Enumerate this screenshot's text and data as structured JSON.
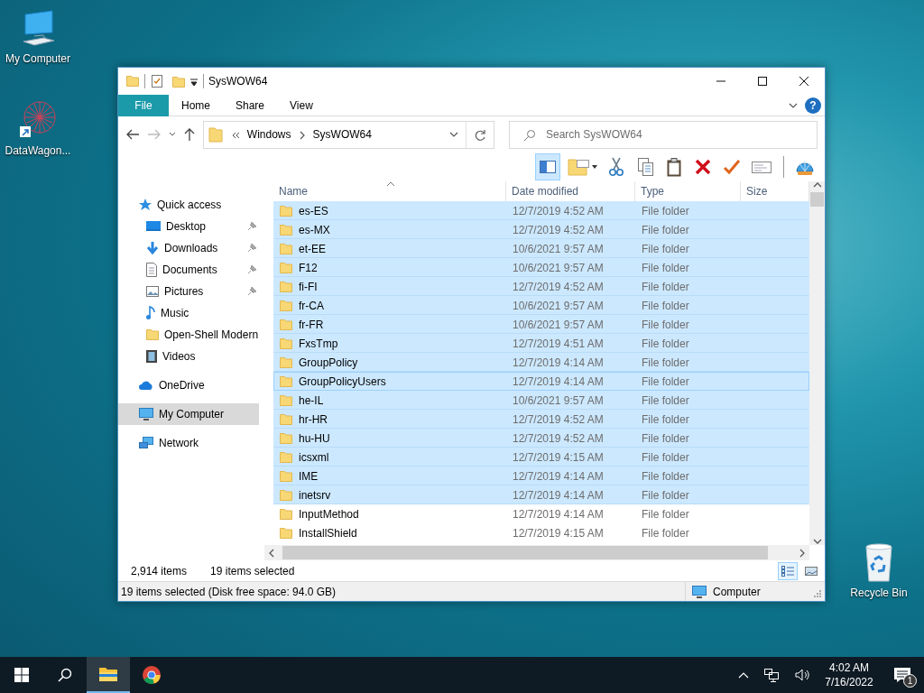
{
  "desktop_icons": [
    {
      "label": "My Computer"
    },
    {
      "label": "DataWagon..."
    },
    {
      "label": "Recycle Bin"
    }
  ],
  "window": {
    "title": "SysWOW64",
    "ribbon_tabs": [
      {
        "label": "File",
        "kind": "menu"
      },
      {
        "label": "Home",
        "kind": "tab"
      },
      {
        "label": "Share",
        "kind": "tab"
      },
      {
        "label": "View",
        "kind": "tab"
      }
    ],
    "help": "?",
    "address": {
      "crumbs": [
        "Windows",
        "SysWOW64"
      ]
    },
    "search": {
      "placeholder": "Search SysWOW64"
    },
    "toolbar": [
      {
        "on": true
      },
      {
        "on": false
      },
      {
        "on": false
      },
      {
        "on": false
      },
      {
        "on": false
      },
      {
        "on": false
      },
      {
        "on": false
      },
      {
        "on": false
      },
      {
        "on": false
      }
    ],
    "nav": [
      {
        "label": "Quick access",
        "selected": false,
        "children": [
          {
            "label": "Desktop",
            "pinned": true,
            "selected": false
          },
          {
            "label": "Downloads",
            "pinned": true,
            "selected": false
          },
          {
            "label": "Documents",
            "pinned": true,
            "selected": false
          },
          {
            "label": "Pictures",
            "pinned": true,
            "selected": false
          },
          {
            "label": "Music",
            "pinned": false,
            "selected": false
          },
          {
            "label": "Open-Shell Modern",
            "pinned": false,
            "selected": false
          },
          {
            "label": "Videos",
            "pinned": false,
            "selected": false
          }
        ]
      },
      {
        "label": "OneDrive",
        "selected": false
      },
      {
        "label": "My Computer",
        "selected": true
      },
      {
        "label": "Network",
        "selected": false
      }
    ],
    "columns": [
      "Name",
      "Date modified",
      "Type",
      "Size"
    ],
    "rows": [
      {
        "name": "es-ES",
        "date": "12/7/2019 4:52 AM",
        "type": "File folder",
        "selected": true,
        "focused": false
      },
      {
        "name": "es-MX",
        "date": "12/7/2019 4:52 AM",
        "type": "File folder",
        "selected": true,
        "focused": false
      },
      {
        "name": "et-EE",
        "date": "10/6/2021 9:57 AM",
        "type": "File folder",
        "selected": true,
        "focused": false
      },
      {
        "name": "F12",
        "date": "10/6/2021 9:57 AM",
        "type": "File folder",
        "selected": true,
        "focused": false
      },
      {
        "name": "fi-FI",
        "date": "12/7/2019 4:52 AM",
        "type": "File folder",
        "selected": true,
        "focused": false
      },
      {
        "name": "fr-CA",
        "date": "10/6/2021 9:57 AM",
        "type": "File folder",
        "selected": true,
        "focused": false
      },
      {
        "name": "fr-FR",
        "date": "10/6/2021 9:57 AM",
        "type": "File folder",
        "selected": true,
        "focused": false
      },
      {
        "name": "FxsTmp",
        "date": "12/7/2019 4:51 AM",
        "type": "File folder",
        "selected": true,
        "focused": false
      },
      {
        "name": "GroupPolicy",
        "date": "12/7/2019 4:14 AM",
        "type": "File folder",
        "selected": true,
        "focused": false
      },
      {
        "name": "GroupPolicyUsers",
        "date": "12/7/2019 4:14 AM",
        "type": "File folder",
        "selected": true,
        "focused": true
      },
      {
        "name": "he-IL",
        "date": "10/6/2021 9:57 AM",
        "type": "File folder",
        "selected": true,
        "focused": false
      },
      {
        "name": "hr-HR",
        "date": "12/7/2019 4:52 AM",
        "type": "File folder",
        "selected": true,
        "focused": false
      },
      {
        "name": "hu-HU",
        "date": "12/7/2019 4:52 AM",
        "type": "File folder",
        "selected": true,
        "focused": false
      },
      {
        "name": "icsxml",
        "date": "12/7/2019 4:15 AM",
        "type": "File folder",
        "selected": true,
        "focused": false
      },
      {
        "name": "IME",
        "date": "12/7/2019 4:14 AM",
        "type": "File folder",
        "selected": true,
        "focused": false
      },
      {
        "name": "inetsrv",
        "date": "12/7/2019 4:14 AM",
        "type": "File folder",
        "selected": true,
        "focused": false
      },
      {
        "name": "InputMethod",
        "date": "12/7/2019 4:14 AM",
        "type": "File folder",
        "selected": false,
        "focused": false
      },
      {
        "name": "InstallShield",
        "date": "12/7/2019 4:15 AM",
        "type": "File folder",
        "selected": false,
        "focused": false
      }
    ],
    "item_count": "2,914 items",
    "selection_count": "19 items selected",
    "views": [
      {
        "selected": true
      },
      {
        "selected": false
      }
    ],
    "status": {
      "text": "19 items selected (Disk free space: 94.0 GB)",
      "location": "Computer"
    }
  },
  "taskbar": {
    "apps": [
      {
        "active": true
      },
      {
        "active": false
      }
    ],
    "time": "4:02 AM",
    "date": "7/16/2022",
    "notifications": "1"
  }
}
